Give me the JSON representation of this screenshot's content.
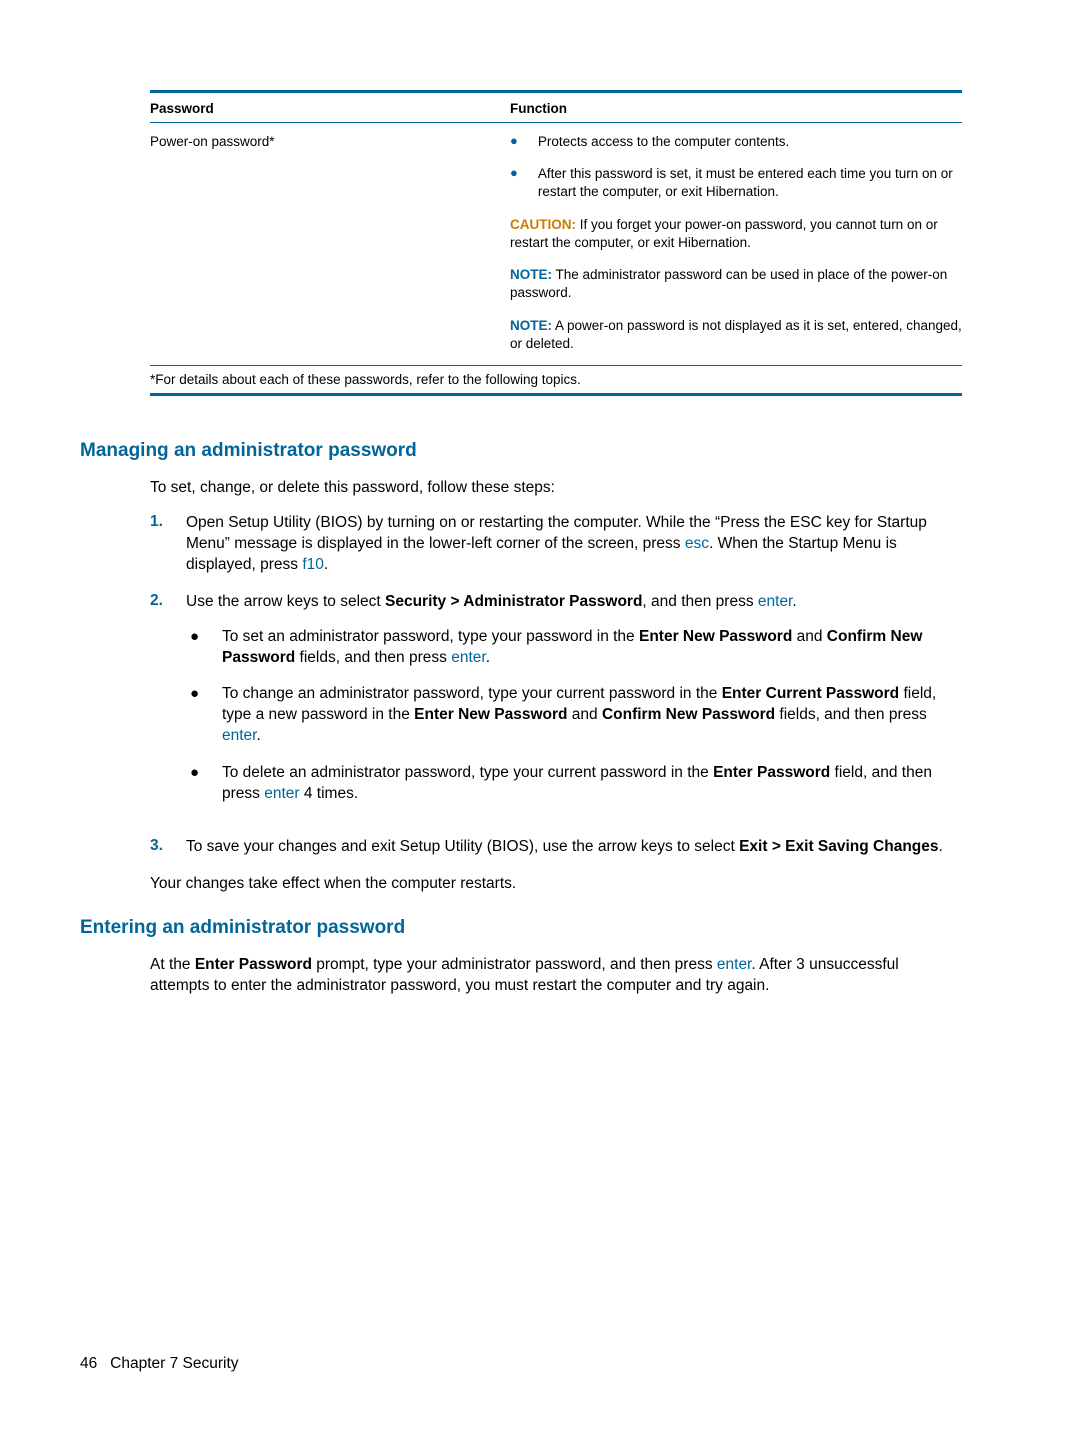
{
  "table": {
    "headers": {
      "password": "Password",
      "function": "Function"
    },
    "row": {
      "label": "Power-on password*",
      "bullets": [
        "Protects access to the computer contents.",
        "After this password is set, it must be entered each time you turn on or restart the computer, or exit Hibernation."
      ],
      "caution": {
        "label": "CAUTION:",
        "text": "If you forget your power-on password, you cannot turn on or restart the computer, or exit Hibernation."
      },
      "note1": {
        "label": "NOTE:",
        "text": "The administrator password can be used in place of the power-on password."
      },
      "note2": {
        "label": "NOTE:",
        "text": "A power-on password is not displayed as it is set, entered, changed, or deleted."
      }
    },
    "footnote": "*For details about each of these passwords, refer to the following topics."
  },
  "section1": {
    "heading": "Managing an administrator password",
    "intro": "To set, change, or delete this password, follow these steps:",
    "steps": {
      "s1": {
        "num": "1.",
        "pre": "Open Setup Utility (BIOS) by turning on or restarting the computer. While the “Press the ESC key for Startup Menu” message is displayed in the lower-left corner of the screen, press ",
        "key1": "esc",
        "mid": ". When the Startup Menu is displayed, press ",
        "key2": "f10",
        "post": "."
      },
      "s2": {
        "num": "2.",
        "pre": "Use the arrow keys to select ",
        "bold": "Security > Administrator Password",
        "mid": ", and then press ",
        "key": "enter",
        "post": ".",
        "sub": {
          "a": {
            "pre": "To set an administrator password, type your password in the ",
            "b1": "Enter New Password",
            "mid1": " and ",
            "b2": "Confirm New Password",
            "mid2": " fields, and then press ",
            "key": "enter",
            "post": "."
          },
          "b": {
            "pre": "To change an administrator password, type your current password in the ",
            "b1": "Enter Current Password",
            "mid1": " field, type a new password in the ",
            "b2": "Enter New Password",
            "mid2": " and ",
            "b3": "Confirm New Password",
            "mid3": " fields, and then press ",
            "key": "enter",
            "post": "."
          },
          "c": {
            "pre": "To delete an administrator password, type your current password in the ",
            "b1": "Enter Password",
            "mid1": " field, and then press ",
            "key": "enter",
            "post": " 4 times."
          }
        }
      },
      "s3": {
        "num": "3.",
        "pre": "To save your changes and exit Setup Utility (BIOS), use the arrow keys to select ",
        "bold": "Exit > Exit Saving Changes",
        "post": "."
      }
    },
    "outro": "Your changes take effect when the computer restarts."
  },
  "section2": {
    "heading": "Entering an administrator password",
    "para": {
      "pre": "At the ",
      "b1": "Enter Password",
      "mid1": " prompt, type your administrator password, and then press ",
      "key": "enter",
      "post": ". After 3 unsuccessful attempts to enter the administrator password, you must restart the computer and try again."
    }
  },
  "footer": {
    "page": "46",
    "chapter": "Chapter 7   Security"
  }
}
